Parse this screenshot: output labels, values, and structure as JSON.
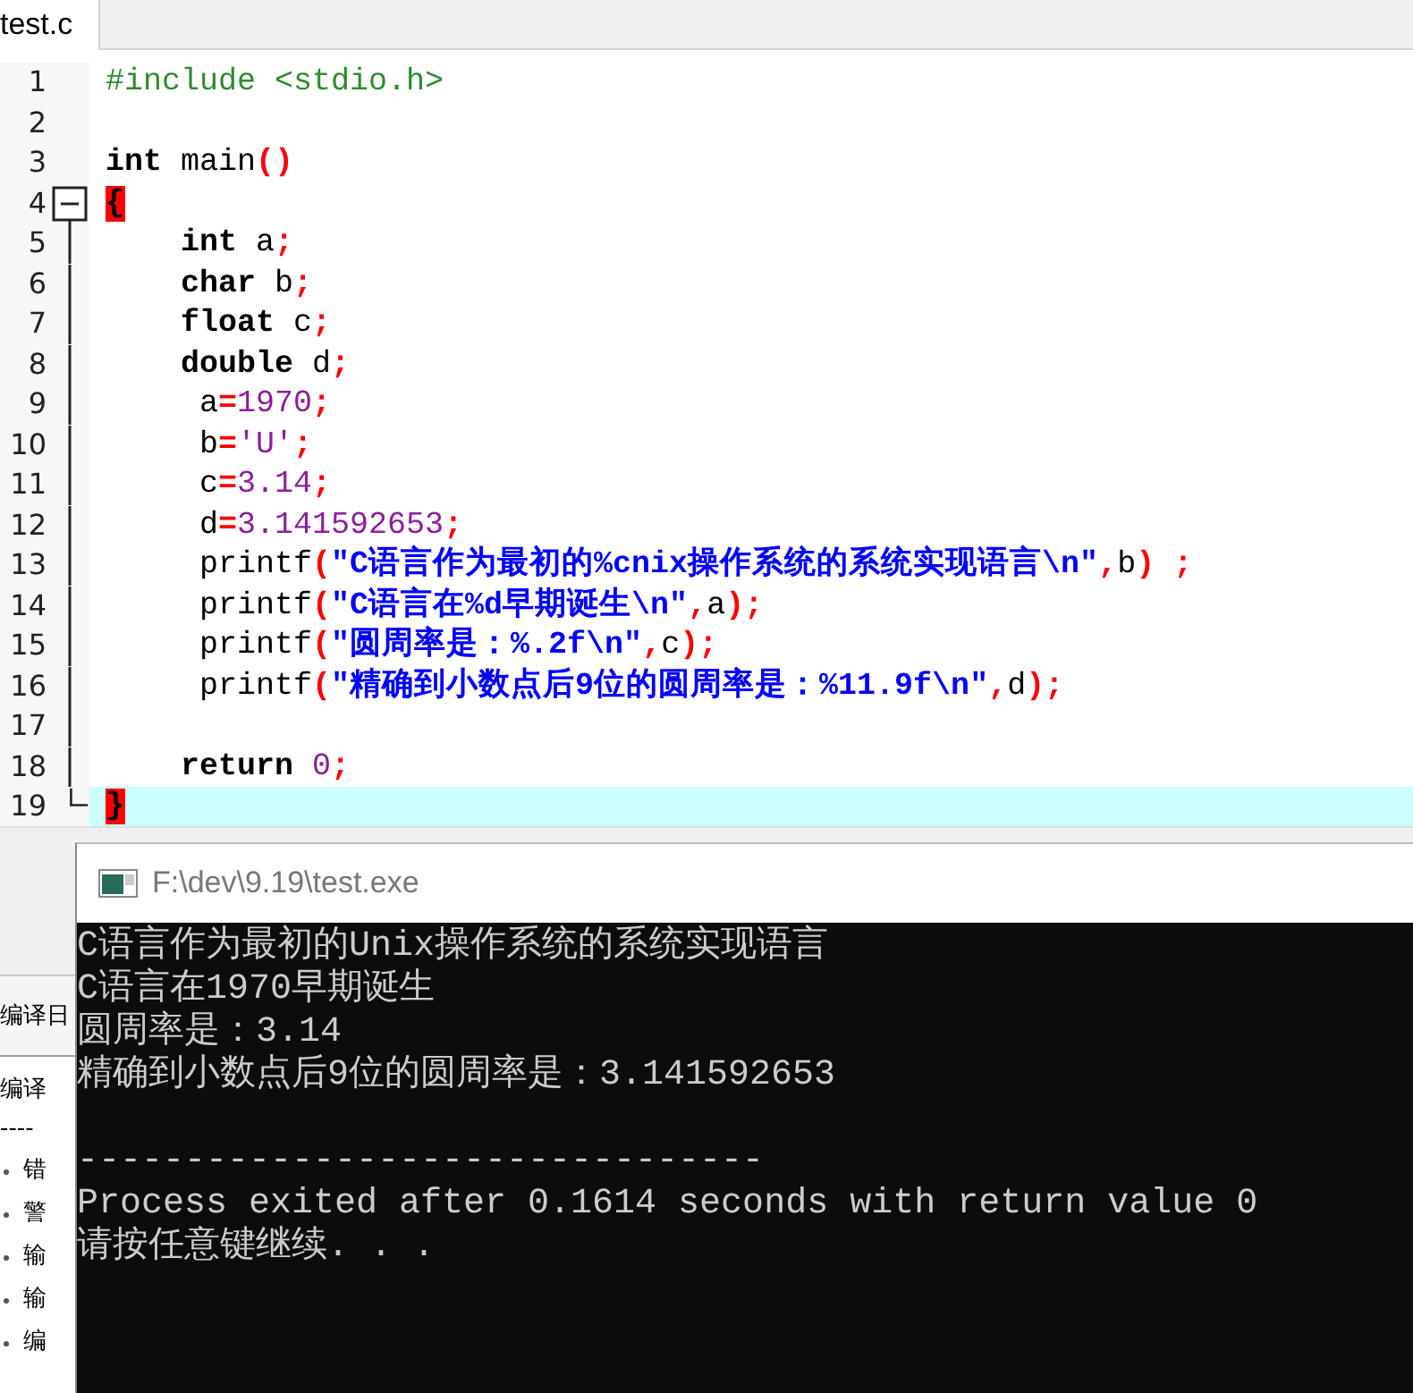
{
  "tabs": [
    {
      "label": "test.c",
      "selected": true
    }
  ],
  "editor": {
    "lines": [
      {
        "number": "1",
        "kind": "plain",
        "tokens": [
          {
            "kind": "pp",
            "text": "#include <stdio.h>"
          }
        ]
      },
      {
        "number": "2",
        "kind": "plain"
      },
      {
        "number": "3",
        "kind": "plain",
        "tokens": [
          {
            "kind": "kw",
            "text": "int"
          },
          {
            "kind": "id",
            "text": " main"
          },
          {
            "kind": "op",
            "text": "()"
          }
        ]
      },
      {
        "number": "4",
        "kind": "fold_start",
        "tokens": [
          {
            "kind": "match",
            "text": "{"
          }
        ]
      },
      {
        "number": "5",
        "kind": "fold_body",
        "tokens": [
          {
            "kind": "kw",
            "text": "    int"
          },
          {
            "kind": "id",
            "text": " a"
          },
          {
            "kind": "op",
            "text": ";"
          }
        ]
      },
      {
        "number": "6",
        "kind": "fold_body",
        "tokens": [
          {
            "kind": "kw",
            "text": "    char"
          },
          {
            "kind": "id",
            "text": " b"
          },
          {
            "kind": "op",
            "text": ";"
          }
        ]
      },
      {
        "number": "7",
        "kind": "fold_body",
        "tokens": [
          {
            "kind": "kw",
            "text": "    float"
          },
          {
            "kind": "id",
            "text": " c"
          },
          {
            "kind": "op",
            "text": ";"
          }
        ]
      },
      {
        "number": "8",
        "kind": "fold_body",
        "tokens": [
          {
            "kind": "kw",
            "text": "    double"
          },
          {
            "kind": "id",
            "text": " d"
          },
          {
            "kind": "op",
            "text": ";"
          }
        ]
      },
      {
        "number": "9",
        "kind": "fold_body",
        "tokens": [
          {
            "kind": "id",
            "text": "     a"
          },
          {
            "kind": "op",
            "text": "="
          },
          {
            "kind": "num",
            "text": "1970"
          },
          {
            "kind": "op",
            "text": ";"
          }
        ]
      },
      {
        "number": "10",
        "kind": "fold_body",
        "tokens": [
          {
            "kind": "id",
            "text": "     b"
          },
          {
            "kind": "op",
            "text": "="
          },
          {
            "kind": "num",
            "text": "'U'"
          },
          {
            "kind": "op",
            "text": ";"
          }
        ]
      },
      {
        "number": "11",
        "kind": "fold_body",
        "tokens": [
          {
            "kind": "id",
            "text": "     c"
          },
          {
            "kind": "op",
            "text": "="
          },
          {
            "kind": "num",
            "text": "3.14"
          },
          {
            "kind": "op",
            "text": ";"
          }
        ]
      },
      {
        "number": "12",
        "kind": "fold_body",
        "tokens": [
          {
            "kind": "id",
            "text": "     d"
          },
          {
            "kind": "op",
            "text": "="
          },
          {
            "kind": "num",
            "text": "3.141592653"
          },
          {
            "kind": "op",
            "text": ";"
          }
        ]
      },
      {
        "number": "13",
        "kind": "fold_body",
        "tokens": [
          {
            "kind": "id",
            "text": "     printf"
          },
          {
            "kind": "op",
            "text": "("
          },
          {
            "kind": "str",
            "text": "\"C语言作为最初的%cnix操作系统的系统实现语言\\n\""
          },
          {
            "kind": "op",
            "text": ","
          },
          {
            "kind": "id",
            "text": "b"
          },
          {
            "kind": "op",
            "text": ") ;"
          }
        ]
      },
      {
        "number": "14",
        "kind": "fold_body",
        "tokens": [
          {
            "kind": "id",
            "text": "     printf"
          },
          {
            "kind": "op",
            "text": "("
          },
          {
            "kind": "str",
            "text": "\"C语言在%d早期诞生\\n\""
          },
          {
            "kind": "op",
            "text": ","
          },
          {
            "kind": "id",
            "text": "a"
          },
          {
            "kind": "op",
            "text": ");"
          }
        ]
      },
      {
        "number": "15",
        "kind": "fold_body",
        "tokens": [
          {
            "kind": "id",
            "text": "     printf"
          },
          {
            "kind": "op",
            "text": "("
          },
          {
            "kind": "str",
            "text": "\"圆周率是：%.2f\\n\""
          },
          {
            "kind": "op",
            "text": ","
          },
          {
            "kind": "id",
            "text": "c"
          },
          {
            "kind": "op",
            "text": ");"
          }
        ]
      },
      {
        "number": "16",
        "kind": "fold_body",
        "tokens": [
          {
            "kind": "id",
            "text": "     printf"
          },
          {
            "kind": "op",
            "text": "("
          },
          {
            "kind": "str",
            "text": "\"精确到小数点后9位的圆周率是：%11.9f\\n\""
          },
          {
            "kind": "op",
            "text": ","
          },
          {
            "kind": "id",
            "text": "d"
          },
          {
            "kind": "op",
            "text": ");"
          }
        ]
      },
      {
        "number": "17",
        "kind": "fold_body"
      },
      {
        "number": "18",
        "kind": "fold_body",
        "tokens": [
          {
            "kind": "kw",
            "text": "    return"
          },
          {
            "kind": "num",
            "text": " 0"
          },
          {
            "kind": "op",
            "text": ";"
          }
        ]
      },
      {
        "number": "19",
        "kind": "fold_end",
        "current": true,
        "tokens": [
          {
            "kind": "match",
            "text": "}"
          }
        ]
      }
    ]
  },
  "log_panel": {
    "tab": "编译日",
    "lines": [
      "编译",
      "----"
    ],
    "items": [
      "错",
      "警",
      "输",
      "输",
      "编"
    ]
  },
  "console": {
    "title": "F:\\dev\\9.19\\test.exe",
    "lines": [
      {
        "kind": "output",
        "text": "C语言作为最初的Unix操作系统的系统实现语言"
      },
      {
        "kind": "output",
        "text": "C语言在1970早期诞生"
      },
      {
        "kind": "output",
        "text": "圆周率是：3.14"
      },
      {
        "kind": "output",
        "text": "精确到小数点后9位的圆周率是：3.141592653"
      },
      {
        "kind": "separator",
        "text": "--------------------------------"
      },
      {
        "kind": "output",
        "text": "Process exited after 0.1614 seconds with return value 0"
      },
      {
        "kind": "output",
        "text": "请按任意键继续. . ."
      }
    ]
  }
}
